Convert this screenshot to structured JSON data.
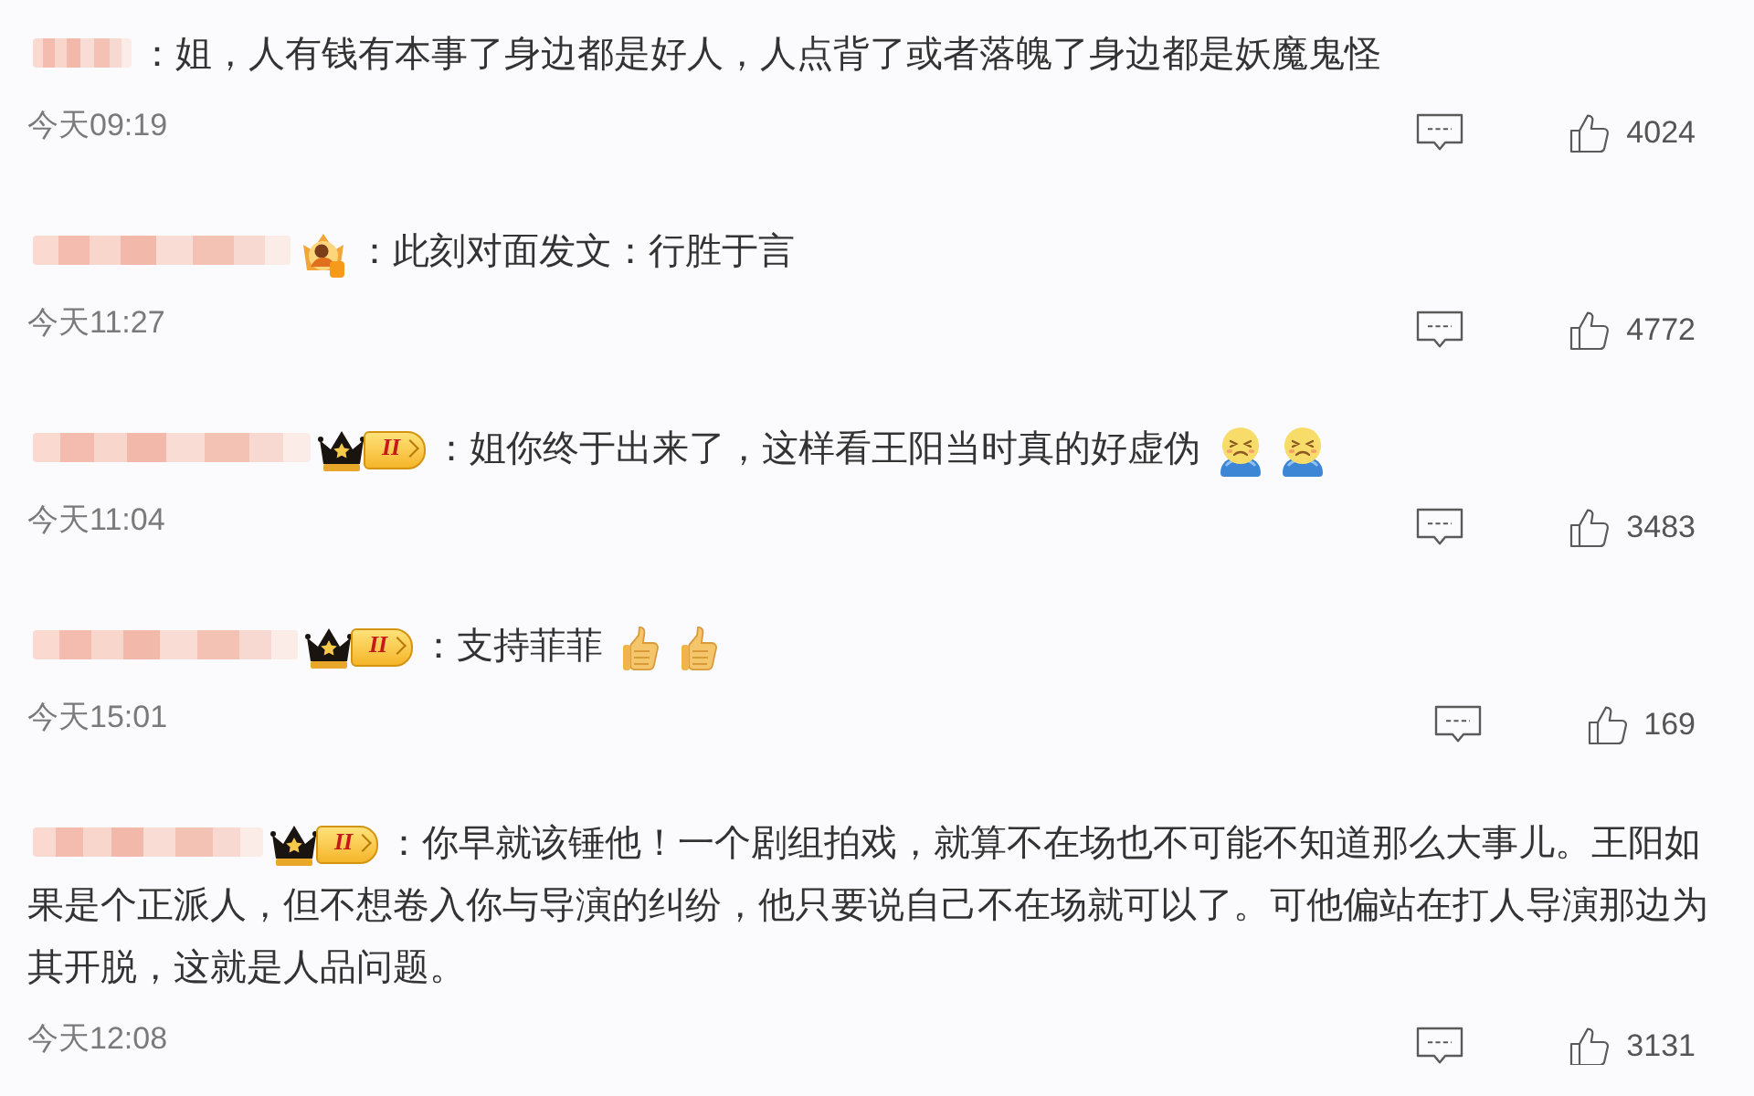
{
  "comments": [
    {
      "text": "：姐，人有钱有本事了身边都是好人，人点背了或者落魄了身边都是妖魔鬼怪",
      "time": "今天09:19",
      "likes": "4024"
    },
    {
      "badge": {
        "kind": "medal"
      },
      "text": "：此刻对面发文：行胜于言",
      "time": "今天11:27",
      "likes": "4772"
    },
    {
      "badge": {
        "kind": "crown",
        "label": "II"
      },
      "text": "：姐你终于出来了，这样看王阳当时真的好虚伪",
      "emojis": [
        {
          "kind": "frown"
        },
        {
          "kind": "frown"
        }
      ],
      "time": "今天11:04",
      "likes": "3483"
    },
    {
      "badge": {
        "kind": "crown",
        "label": "II"
      },
      "text": "：支持菲菲",
      "emojis": [
        {
          "kind": "thumbs_up"
        },
        {
          "kind": "thumbs_up"
        }
      ],
      "time": "今天15:01",
      "likes": "169"
    },
    {
      "badge": {
        "kind": "crown",
        "label": "II"
      },
      "text": "：你早就该锤他！一个剧组拍戏，就算不在场也不可能不知道那么大事儿。王阳如果是个正派人，但不想卷入你与导演的纠纷，他只要说自己不在场就可以了。可他偏站在打人导演那边为其开脱，这就是人品问题。",
      "time": "今天12:08",
      "likes": "3131"
    }
  ]
}
